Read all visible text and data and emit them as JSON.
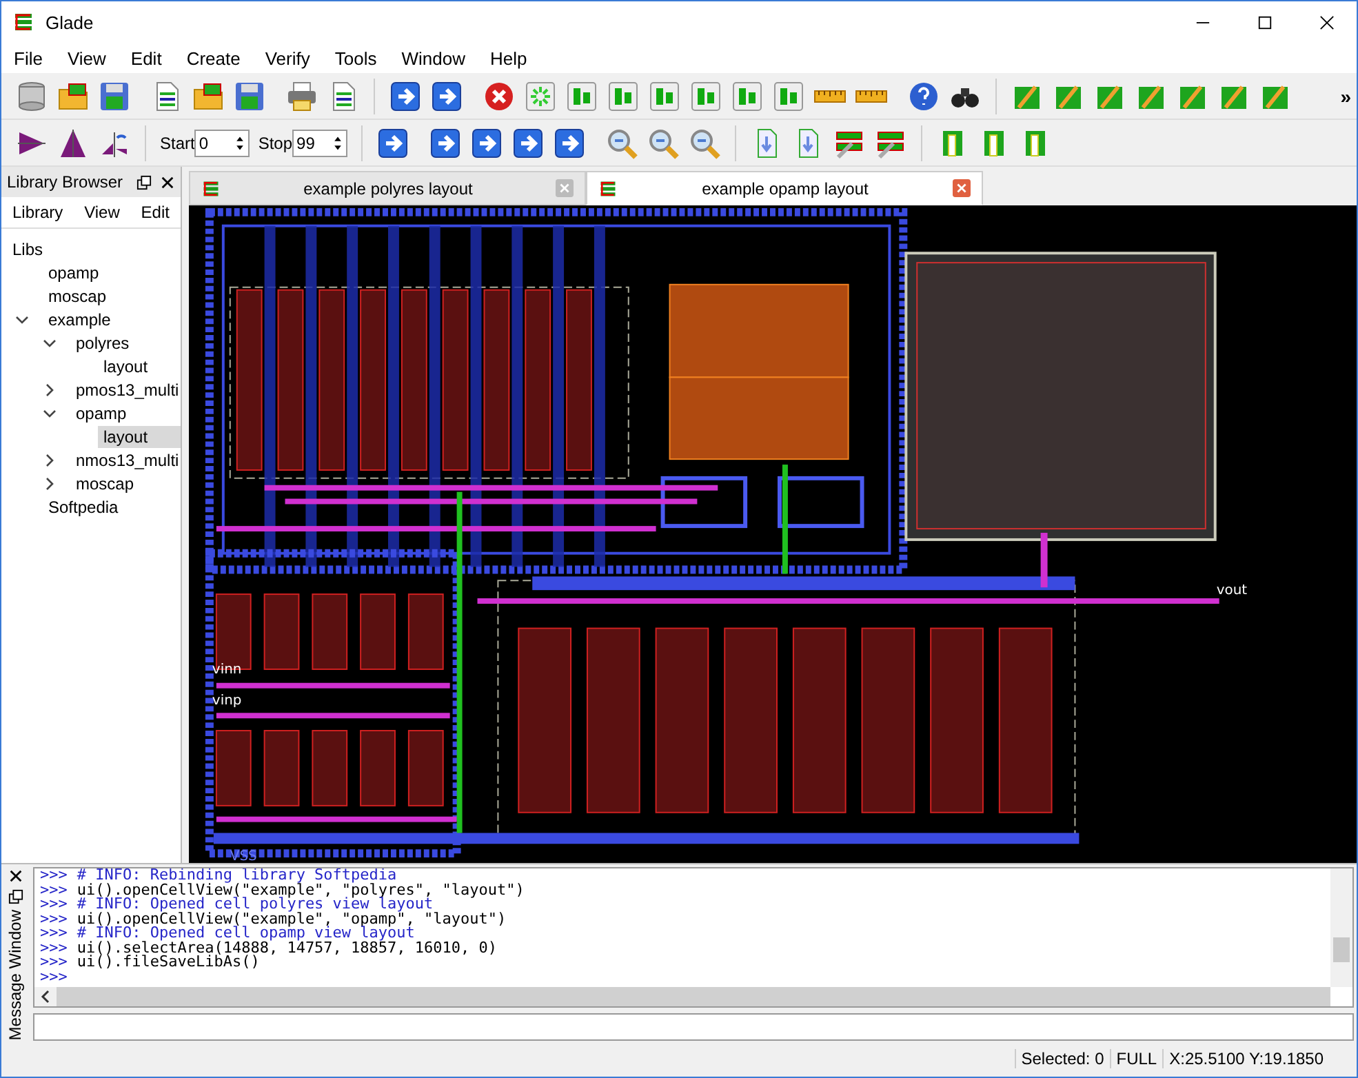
{
  "window": {
    "title": "Glade"
  },
  "menu": [
    "File",
    "View",
    "Edit",
    "Create",
    "Verify",
    "Tools",
    "Window",
    "Help"
  ],
  "toolbar": {
    "overflow": "»",
    "start": {
      "label": "Start",
      "value": "0"
    },
    "stop": {
      "label": "Stop",
      "value": "99"
    }
  },
  "library_browser": {
    "title": "Library Browser",
    "menu": [
      "Library",
      "View",
      "Edit"
    ],
    "tree": [
      {
        "label": "Libs",
        "selected": false,
        "children": [
          {
            "label": "opamp",
            "selected": false
          },
          {
            "label": "moscap",
            "selected": false
          },
          {
            "label": "example",
            "expanded": true,
            "selected": false,
            "children": [
              {
                "label": "polyres",
                "expanded": true,
                "selected": false,
                "children": [
                  {
                    "label": "layout",
                    "selected": false
                  }
                ]
              },
              {
                "label": "pmos13_multi",
                "expanded": false,
                "selected": false
              },
              {
                "label": "opamp",
                "expanded": true,
                "selected": false,
                "children": [
                  {
                    "label": "layout",
                    "selected": true
                  }
                ]
              },
              {
                "label": "nmos13_multi",
                "expanded": false,
                "selected": false
              },
              {
                "label": "moscap",
                "expanded": false,
                "selected": false
              }
            ]
          },
          {
            "label": "Softpedia",
            "selected": false
          }
        ]
      }
    ]
  },
  "tabs": [
    {
      "label": "example polyres layout",
      "selected": false
    },
    {
      "label": "example opamp layout",
      "selected": true
    }
  ],
  "canvas_labels": [
    "vout",
    "vinn",
    "vinp",
    "VSS"
  ],
  "message_window": {
    "title": "Message Window",
    "lines": [
      {
        "prompt": ">>>",
        "kind": "info",
        "text": "# INFO: Rebinding library Softpedia"
      },
      {
        "prompt": ">>>",
        "kind": "command",
        "text": "ui().openCellView(\"example\", \"polyres\", \"layout\")"
      },
      {
        "prompt": ">>>",
        "kind": "info",
        "text": "# INFO: Opened cell polyres view layout"
      },
      {
        "prompt": ">>>",
        "kind": "command",
        "text": "ui().openCellView(\"example\", \"opamp\", \"layout\")"
      },
      {
        "prompt": ">>>",
        "kind": "info",
        "text": "# INFO: Opened cell opamp view layout"
      },
      {
        "prompt": ">>>",
        "kind": "command",
        "text": "ui().selectArea(14888, 14757, 18857, 16010, 0)"
      },
      {
        "prompt": ">>>",
        "kind": "command",
        "text": "ui().fileSaveLibAs()"
      },
      {
        "prompt": ">>>"
      }
    ]
  },
  "status_bar": [
    "Selected: 0",
    "FULL",
    "X:25.5100 Y:19.1850"
  ]
}
